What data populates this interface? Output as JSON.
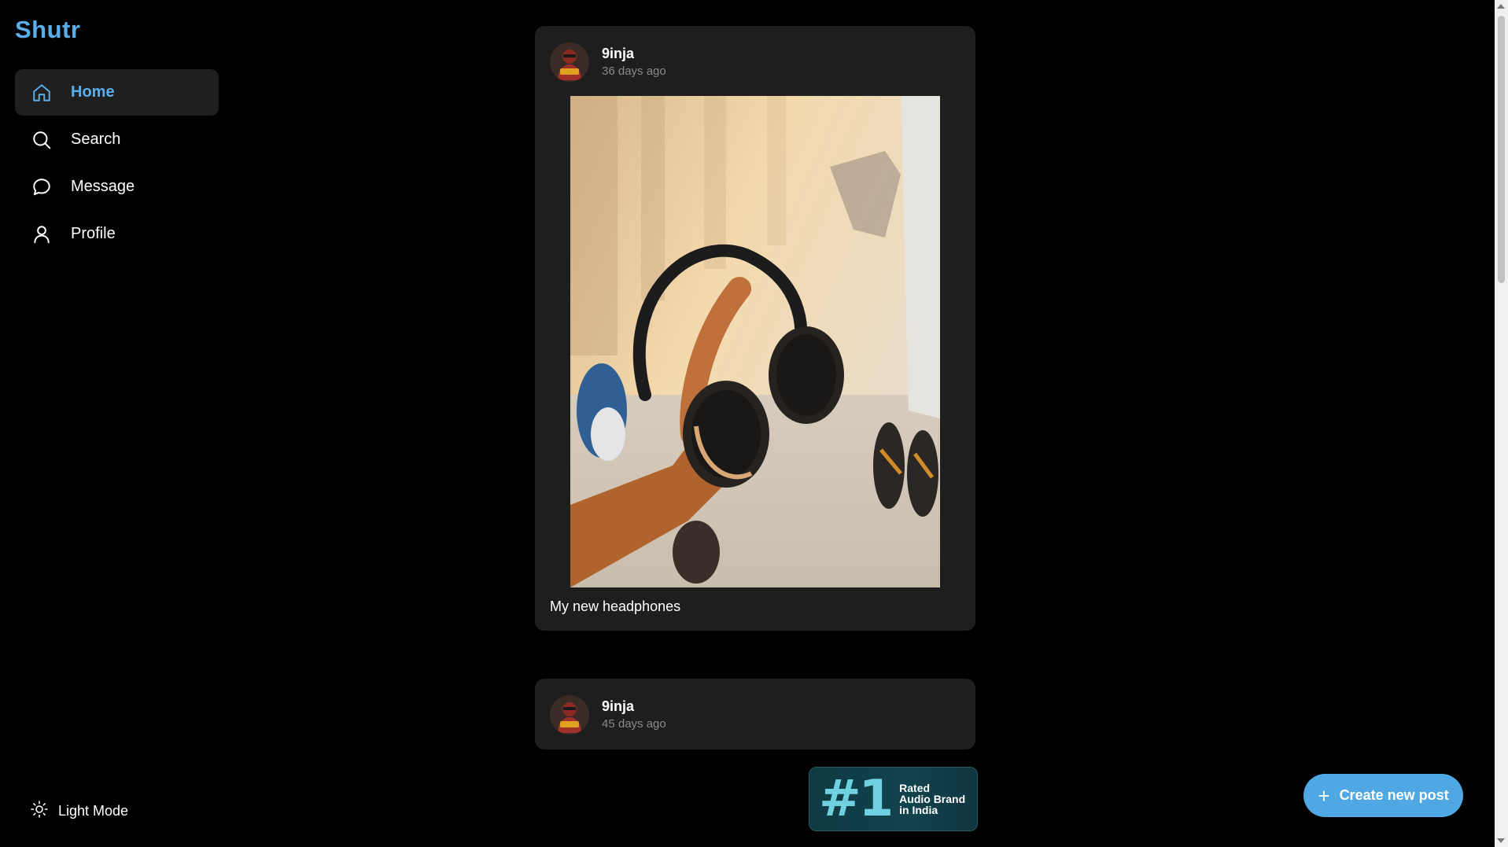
{
  "app": {
    "logo": "Shutr",
    "accent_color": "#5aaeea"
  },
  "sidebar": {
    "items": [
      {
        "label": "Home",
        "icon": "home-icon",
        "active": true
      },
      {
        "label": "Search",
        "icon": "search-icon",
        "active": false
      },
      {
        "label": "Message",
        "icon": "message-icon",
        "active": false
      },
      {
        "label": "Profile",
        "icon": "user-icon",
        "active": false
      }
    ],
    "light_mode_label": "Light Mode"
  },
  "feed": {
    "posts": [
      {
        "username": "9inja",
        "time": "36 days ago",
        "caption": "My new headphones",
        "image": "headphones-photo"
      },
      {
        "username": "9inja",
        "time": "45 days ago"
      }
    ]
  },
  "ad": {
    "big_text": "#1",
    "line1": "Rated",
    "line2": "Audio Brand",
    "line3": "in India"
  },
  "create_button": {
    "label": "Create new post",
    "icon": "plus-icon",
    "color": "#4fa8e4"
  }
}
